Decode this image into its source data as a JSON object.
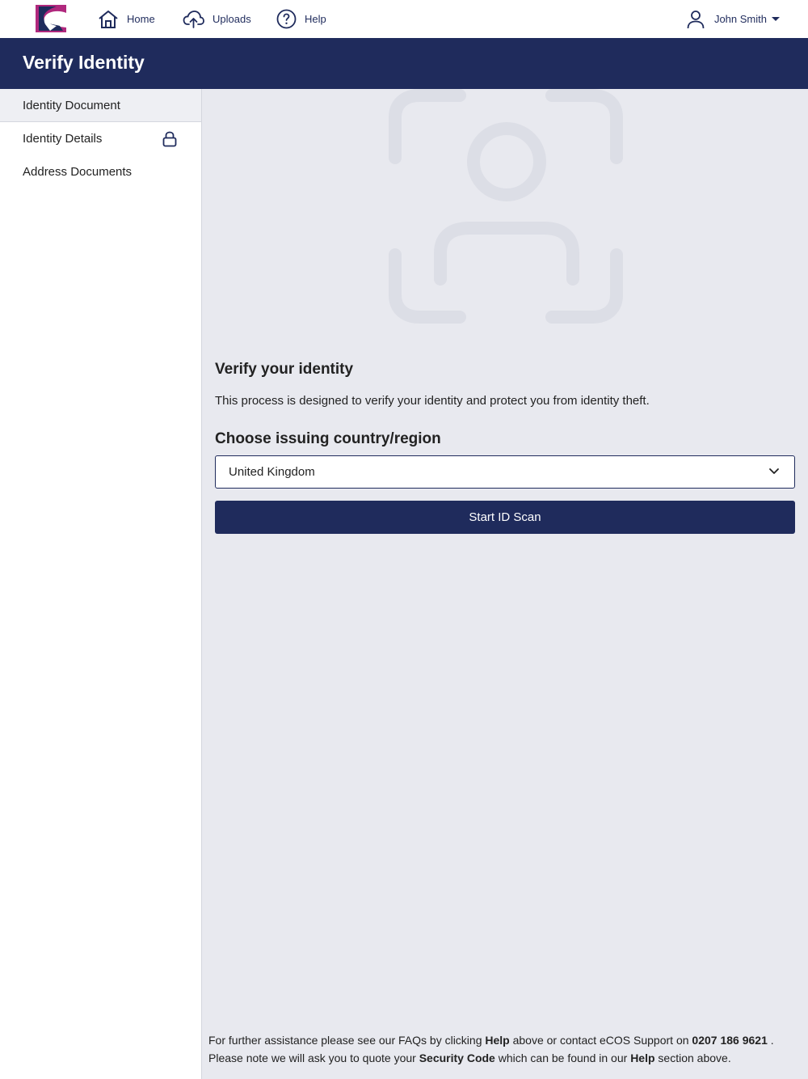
{
  "nav": {
    "home": "Home",
    "uploads": "Uploads",
    "help": "Help",
    "user": "John Smith"
  },
  "title": "Verify Identity",
  "sidebar": {
    "items": [
      {
        "label": "Identity Document"
      },
      {
        "label": "Identity Details"
      },
      {
        "label": "Address Documents"
      }
    ]
  },
  "main": {
    "heading": "Verify your identity",
    "description": "This process is designed to verify your identity and protect you from identity theft.",
    "country_label": "Choose issuing country/region",
    "country_value": "United Kingdom",
    "start_button": "Start ID Scan"
  },
  "footer": {
    "p1": "For further assistance please see our FAQs by clicking ",
    "help1": "Help",
    "p2": " above or contact eCOS Support on ",
    "phone": "0207 186 9621",
    "p3": " .",
    "p4": "Please note we will ask you to quote your ",
    "security_code": "Security Code",
    "p5": " which can be found in our ",
    "help2": "Help",
    "p6": " section above."
  },
  "colors": {
    "brand_navy": "#1f2b5c",
    "brand_magenta": "#b0287d",
    "background": "#e8e9ef"
  },
  "icons": {
    "home": "home-icon",
    "uploads": "cloud-upload-icon",
    "help": "help-circle-icon",
    "user": "user-icon",
    "lock": "lock-icon",
    "select": "chevron-down-icon"
  }
}
